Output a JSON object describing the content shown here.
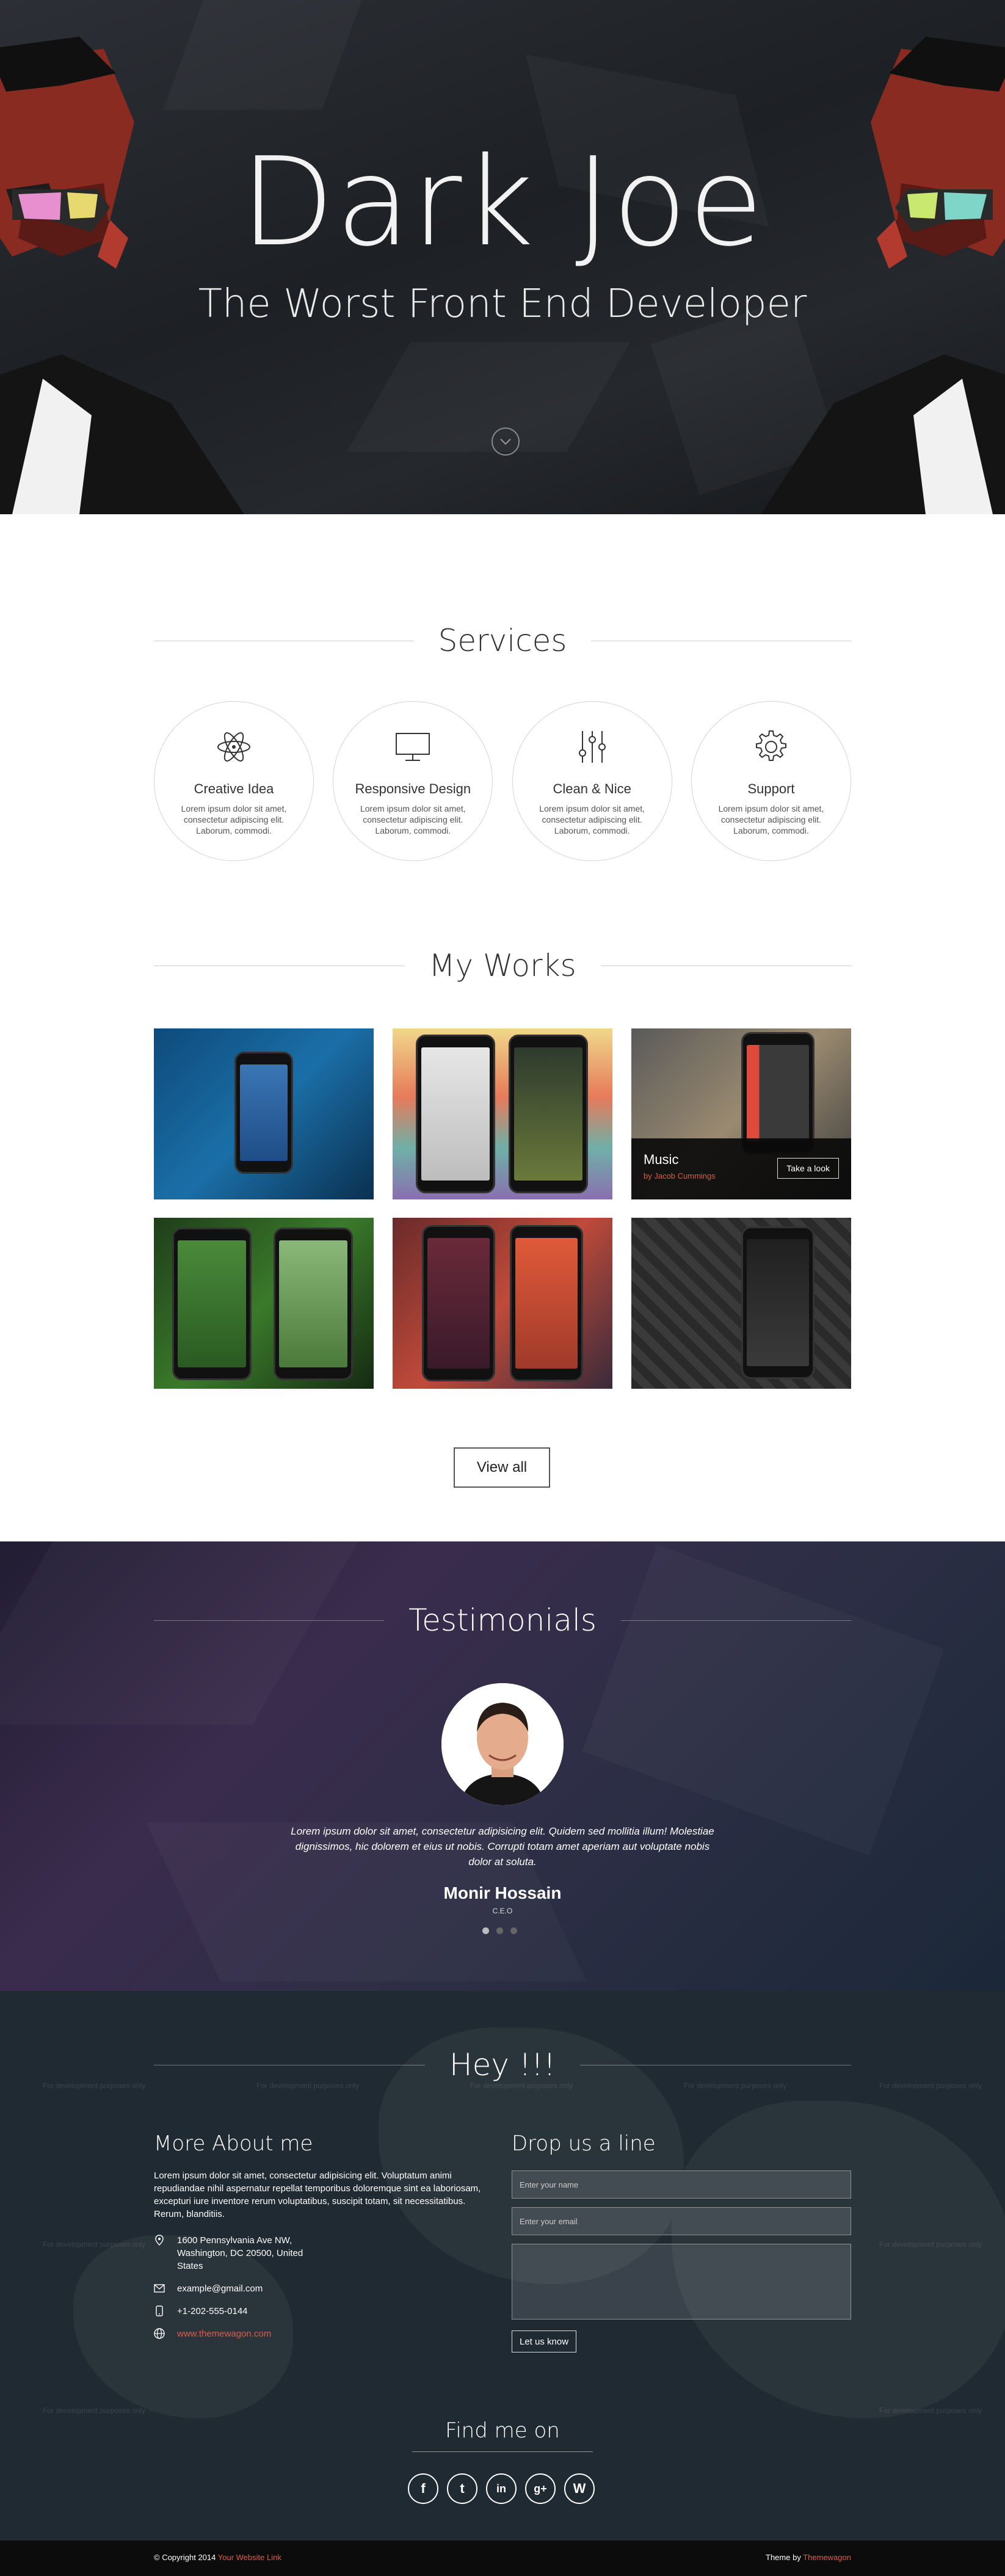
{
  "hero": {
    "title": "Dark Joe",
    "subtitle": "The Worst Front End Developer",
    "scroll_icon": "chevron-down-icon"
  },
  "services": {
    "title": "Services",
    "items": [
      {
        "icon": "atom-icon",
        "title": "Creative Idea",
        "text": "Lorem ipsum dolor sit amet, consectetur adipiscing elit. Laborum, commodi."
      },
      {
        "icon": "monitor-icon",
        "title": "Responsive Design",
        "text": "Lorem ipsum dolor sit amet, consectetur adipiscing elit. Laborum, commodi."
      },
      {
        "icon": "sliders-icon",
        "title": "Clean & Nice",
        "text": "Lorem ipsum dolor sit amet, consectetur adipiscing elit. Laborum, commodi."
      },
      {
        "icon": "gear-icon",
        "title": "Support",
        "text": "Lorem ipsum dolor sit amet, consectetur adipiscing elit. Laborum, commodi."
      }
    ]
  },
  "works": {
    "title": "My Works",
    "featured": {
      "title": "Music",
      "author": "by Jacob Cummings",
      "button": "Take a look"
    },
    "view_all": "View all"
  },
  "testimonials": {
    "title": "Testimonials",
    "quote": "Lorem ipsum dolor sit amet, consectetur adipisicing elit. Quidem sed mollitia illum! Molestiae dignissimos, hic dolorem et eius ut nobis. Corrupti totam amet aperiam aut voluptate nobis dolor at soluta.",
    "name": "Monir Hossain",
    "role": "C.E.O"
  },
  "contact": {
    "title": "Hey !!!",
    "about_title": "More About me",
    "about_text": "Lorem ipsum dolor sit amet, consectetur adipisicing elit. Voluptatum animi repudiandae nihil aspernatur repellat temporibus doloremque sint ea laboriosam, excepturi iure inventore rerum voluptatibus, suscipit totam, sit necessitatibus. Rerum, blanditiis.",
    "address": "1600 Pennsylvania Ave NW, Washington, DC 20500, United States",
    "email": "example@gmail.com",
    "phone": "+1-202-555-0144",
    "website": "www.themewagon.com",
    "form_title": "Drop us a line",
    "name_placeholder": "Enter your name",
    "email_placeholder": "Enter your email",
    "send": "Let us know",
    "find_title": "Find me on",
    "map_watermark": "For development purposes only"
  },
  "social": [
    {
      "icon": "facebook-icon",
      "glyph": "f"
    },
    {
      "icon": "twitter-icon",
      "glyph": "t"
    },
    {
      "icon": "linkedin-icon",
      "glyph": "in"
    },
    {
      "icon": "google-plus-icon",
      "glyph": "g+"
    },
    {
      "icon": "wordpress-icon",
      "glyph": "W"
    }
  ],
  "footer": {
    "copyright": "© Copyright 2014",
    "site_link": "Your Website Link",
    "theme_by": "Theme by",
    "theme_link": "Themewagon"
  },
  "colors": {
    "accent": "#e05a4a",
    "hero_bg": "#1d2024",
    "contact_bg": "#1f2a33",
    "footer_bg": "#0c0c0c"
  }
}
